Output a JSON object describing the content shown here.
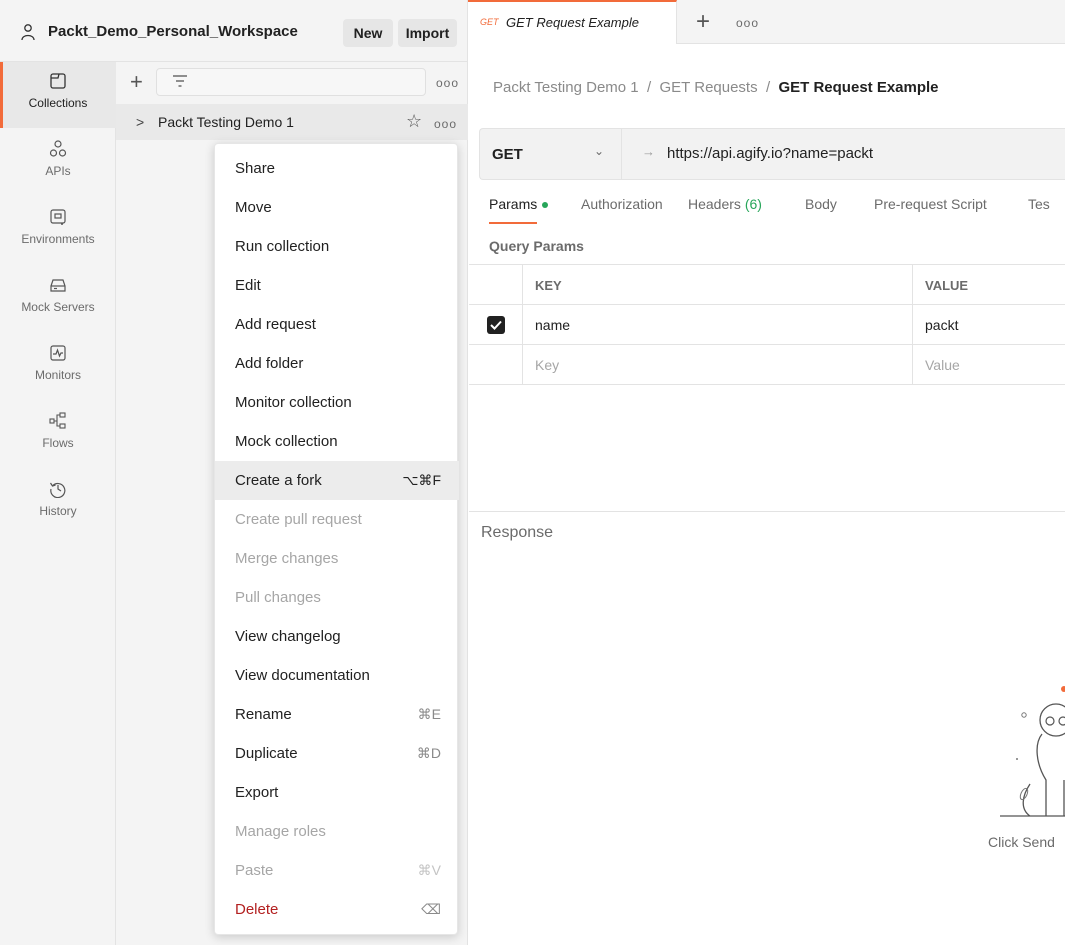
{
  "workspace": {
    "name": "Packt_Demo_Personal_Workspace",
    "new_label": "New",
    "import_label": "Import"
  },
  "nav": {
    "items": [
      {
        "label": "Collections",
        "icon": "collections-icon",
        "active": true
      },
      {
        "label": "APIs",
        "icon": "apis-icon"
      },
      {
        "label": "Environments",
        "icon": "environments-icon"
      },
      {
        "label": "Mock Servers",
        "icon": "mock-servers-icon"
      },
      {
        "label": "Monitors",
        "icon": "monitors-icon"
      },
      {
        "label": "Flows",
        "icon": "flows-icon"
      },
      {
        "label": "History",
        "icon": "history-icon"
      }
    ]
  },
  "sidebar": {
    "more": "ooo",
    "collection": {
      "chevron": ">",
      "name": "Packt Testing Demo 1",
      "star": "☆",
      "more": "ooo"
    }
  },
  "context_menu": {
    "items": [
      {
        "label": "Share"
      },
      {
        "label": "Move"
      },
      {
        "label": "Run collection"
      },
      {
        "label": "Edit"
      },
      {
        "label": "Add request"
      },
      {
        "label": "Add folder"
      },
      {
        "label": "Monitor collection"
      },
      {
        "label": "Mock collection"
      },
      {
        "label": "Create a fork",
        "shortcut": "⌥⌘F",
        "highlighted": true
      },
      {
        "label": "Create pull request",
        "disabled": true
      },
      {
        "label": "Merge changes",
        "disabled": true
      },
      {
        "label": "Pull changes",
        "disabled": true
      },
      {
        "label": "View changelog"
      },
      {
        "label": "View documentation"
      },
      {
        "label": "Rename",
        "shortcut": "⌘E"
      },
      {
        "label": "Duplicate",
        "shortcut": "⌘D"
      },
      {
        "label": "Export"
      },
      {
        "label": "Manage roles",
        "disabled": true
      },
      {
        "label": "Paste",
        "shortcut": "⌘V",
        "disabled": true
      },
      {
        "label": "Delete",
        "shortcut": "⌫",
        "danger": true
      }
    ]
  },
  "tabs": {
    "active": {
      "method": "GET",
      "title": "GET Request Example"
    },
    "plus": "+",
    "more": "ooo"
  },
  "breadcrumb": {
    "part1": "Packt Testing Demo 1",
    "sep": "/",
    "part2": "GET Requests",
    "current": "GET Request Example"
  },
  "request": {
    "method": "GET",
    "url_arrow": "→",
    "url": "https://api.agify.io?name=packt"
  },
  "request_tabs": {
    "params": "Params",
    "authorization": "Authorization",
    "headers": "Headers",
    "headers_count": "(6)",
    "body": "Body",
    "prerequest": "Pre-request Script",
    "tests": "Tes"
  },
  "query_params": {
    "title": "Query Params",
    "key_header": "KEY",
    "value_header": "VALUE",
    "rows": [
      {
        "key": "name",
        "value": "packt",
        "checked": true
      }
    ],
    "key_placeholder": "Key",
    "value_placeholder": "Value"
  },
  "response": {
    "label": "Response",
    "hint": "Click Send"
  },
  "colors": {
    "accent": "#f26b3a",
    "danger": "#b32020",
    "success": "#27a65a"
  }
}
